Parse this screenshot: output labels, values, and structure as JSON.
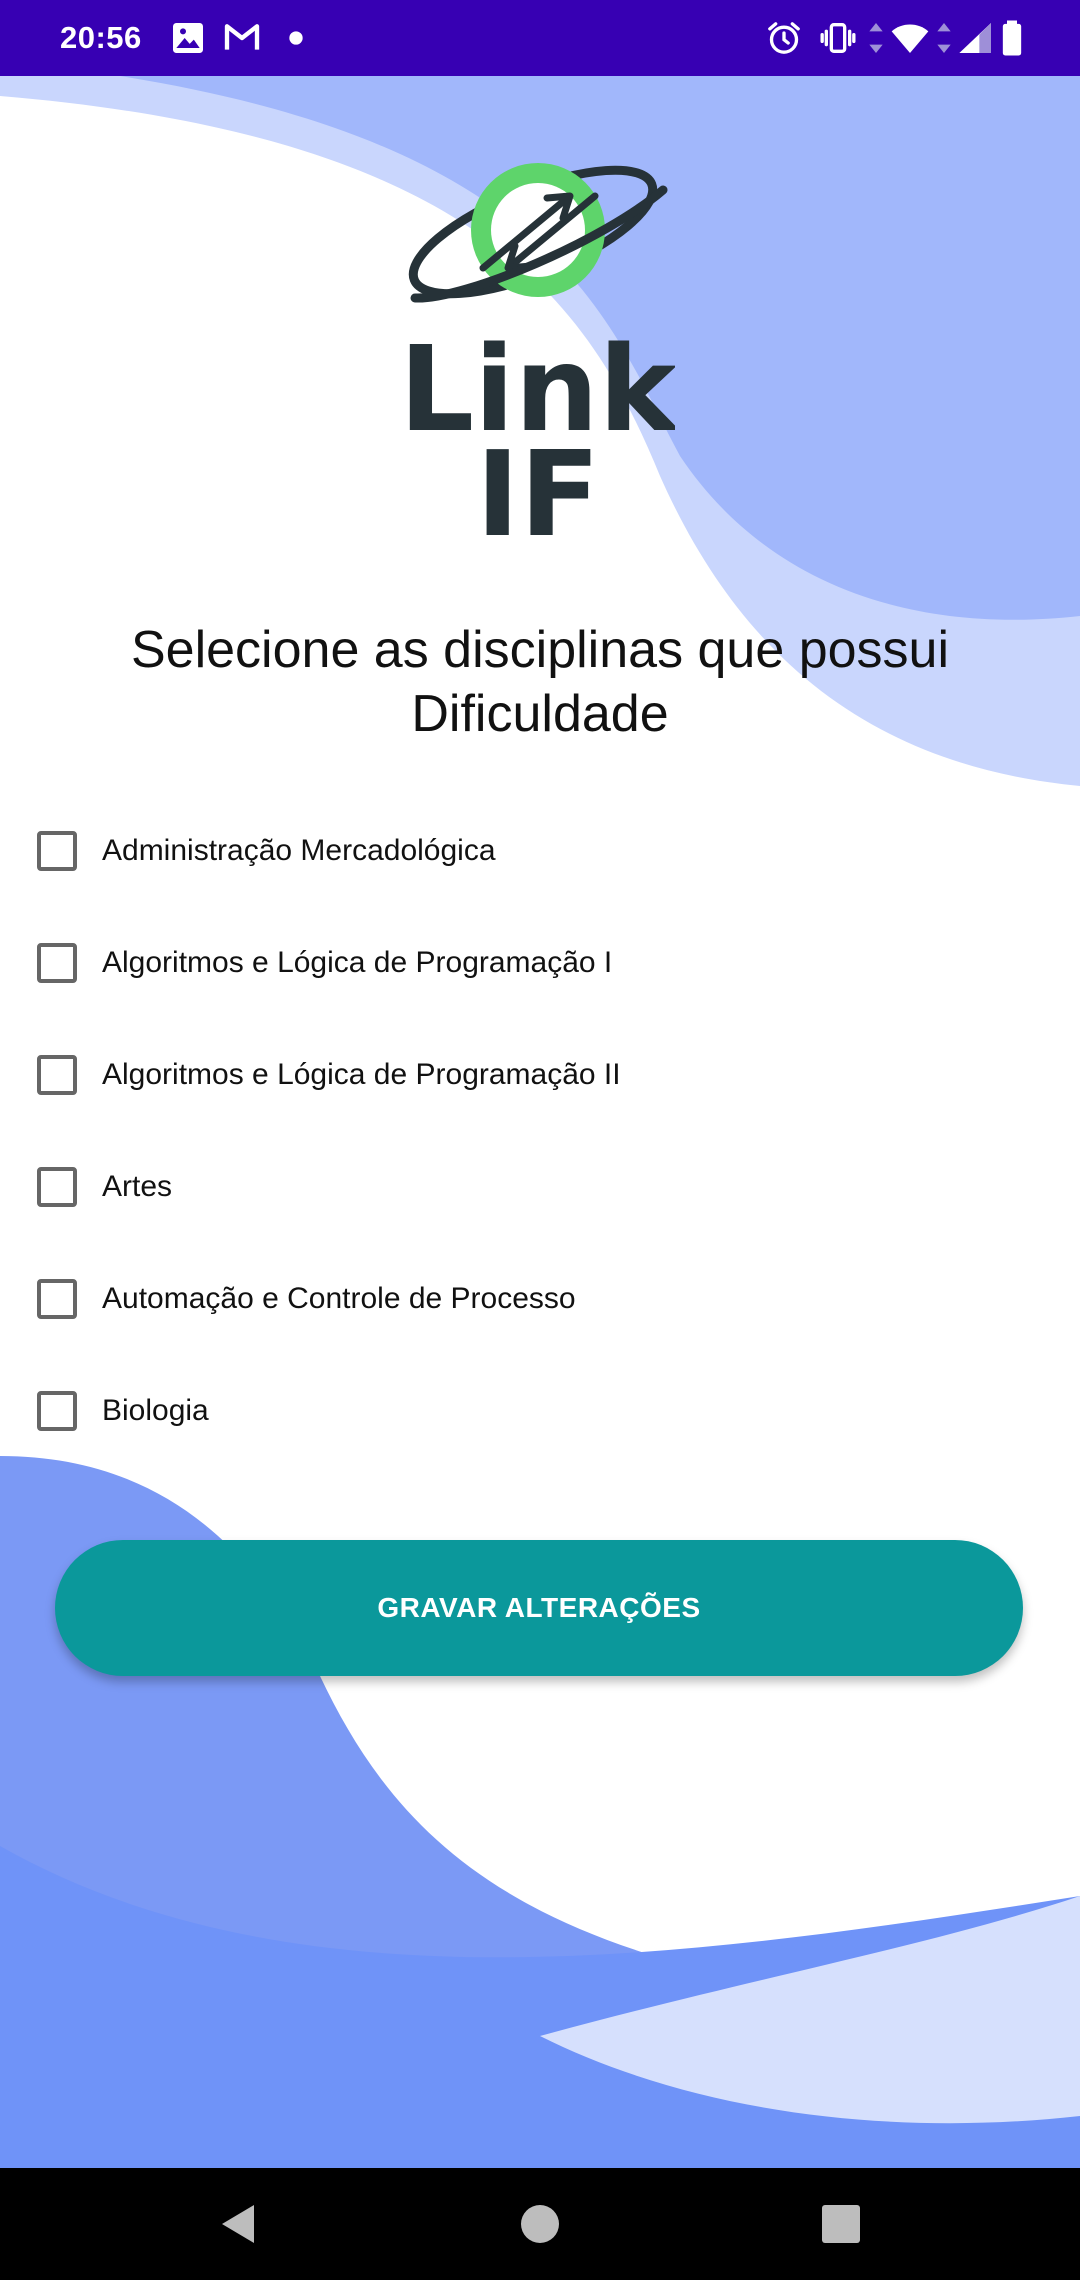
{
  "status_bar": {
    "time": "20:56",
    "left_icons": [
      "image-icon",
      "gmail-icon",
      "dot-icon"
    ],
    "right_icons": [
      "alarm-icon",
      "vibrate-icon",
      "data-arrows-icon",
      "wifi-icon",
      "signal-icon",
      "battery-icon"
    ]
  },
  "logo": {
    "line1": "Link",
    "line2": "IF",
    "ring_color": "#5ed46b",
    "text_color": "#263238"
  },
  "title": "Selecione as disciplinas que possui Dificuldade",
  "subjects": [
    {
      "label": "Administração Mercadológica",
      "checked": false
    },
    {
      "label": "Algoritmos e Lógica de Programação I",
      "checked": false
    },
    {
      "label": "Algoritmos e Lógica de Programação II",
      "checked": false
    },
    {
      "label": "Artes",
      "checked": false
    },
    {
      "label": "Automação e Controle de Processo",
      "checked": false
    },
    {
      "label": "Biologia",
      "checked": false
    }
  ],
  "save_button": {
    "label": "GRAVAR ALTERAÇÕES"
  },
  "navigation": [
    "back-icon",
    "home-icon",
    "recents-icon"
  ],
  "colors": {
    "status_bar": "#3700b3",
    "accent_button": "#0b989b",
    "wave_dark": "#7b99f5",
    "wave_light": "#c9d6fd"
  }
}
